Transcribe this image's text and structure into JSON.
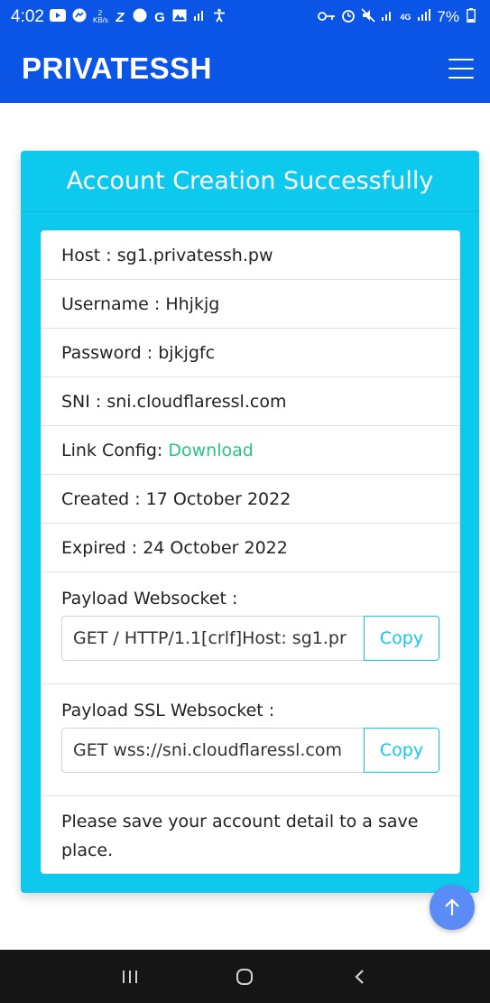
{
  "status_bar": {
    "time": "4:02",
    "left_icons": [
      "youtube-icon",
      "messenger-icon",
      "data-speed-icon",
      "z-icon",
      "circle-app-icon",
      "google-icon",
      "gallery-icon",
      "signal-small-icon",
      "accessibility-icon"
    ],
    "right_icons": [
      "key-icon",
      "alarm-icon",
      "mute-icon",
      "signal-icon",
      "4g-icon",
      "signal-bars-icon"
    ],
    "data_speed": "2 KB/s",
    "network": "4G",
    "battery": "7%"
  },
  "navbar": {
    "brand": "PRIVATESSH"
  },
  "card": {
    "title": "Account Creation Successfully",
    "host": "Host : sg1.privatessh.pw",
    "username": "Username : Hhjkjg",
    "password": "Password : bjkjgfc",
    "sni": "SNI : sni.cloudflaressl.com",
    "link_config_label": "Link Config: ",
    "link_config_link": "Download",
    "created": "Created : 17 October 2022",
    "expired": "Expired : 24 October 2022",
    "payload_ws": {
      "label": "Payload Websocket :",
      "value": "GET / HTTP/1.1[crlf]Host: sg1.pr",
      "copy_label": "Copy"
    },
    "payload_ssl_ws": {
      "label": "Payload SSL Websocket :",
      "value": "GET wss://sni.cloudflaressl.com",
      "copy_label": "Copy"
    },
    "note": "Please save your account detail to a save place."
  },
  "colors": {
    "brand_blue": "#0a55e5",
    "card_cyan": "#0ec9ee",
    "link_green": "#28c28a",
    "scroll_button": "#5b8cf5"
  }
}
